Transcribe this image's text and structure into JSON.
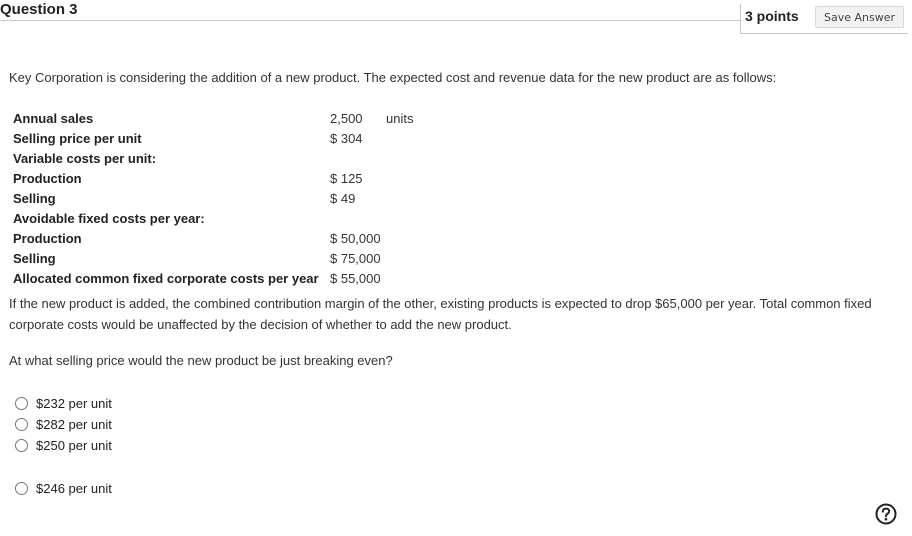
{
  "header": {
    "question_title": "Question 3",
    "points": "3 points",
    "save_label": "Save Answer"
  },
  "intro": "Key Corporation is considering the addition of a new product. The expected cost and revenue data for the new product are as follows:",
  "data_table": {
    "rows": [
      {
        "label": "Annual sales",
        "value": "2,500",
        "unit": "units"
      },
      {
        "label": "Selling price per unit",
        "value": "$ 304",
        "unit": ""
      },
      {
        "label": "Variable costs per unit:",
        "value": "",
        "unit": ""
      },
      {
        "label": "Production",
        "value": "$ 125",
        "unit": ""
      },
      {
        "label": "Selling",
        "value": "$ 49",
        "unit": ""
      },
      {
        "label": "Avoidable fixed costs per year:",
        "value": "",
        "unit": ""
      },
      {
        "label": "Production",
        "value": "$ 50,000",
        "unit": ""
      },
      {
        "label": "Selling",
        "value": "$ 75,000",
        "unit": ""
      },
      {
        "label": "Allocated common fixed corporate costs per year",
        "value": "$ 55,000",
        "unit": ""
      }
    ]
  },
  "paragraph": "If the new product is added, the combined contribution margin of the other, existing products is expected to drop $65,000 per year. Total common fixed corporate costs would be unaffected by the decision of whether to add the new product.",
  "question": "At what selling price would the new product be just breaking even?",
  "options": [
    {
      "label": "$232 per unit",
      "selected": false
    },
    {
      "label": "$282 per unit",
      "selected": false
    },
    {
      "label": "$250 per unit",
      "selected": false
    },
    {
      "label": "$246 per unit",
      "selected": false
    }
  ],
  "icons": {
    "help": "help-circle-icon"
  }
}
